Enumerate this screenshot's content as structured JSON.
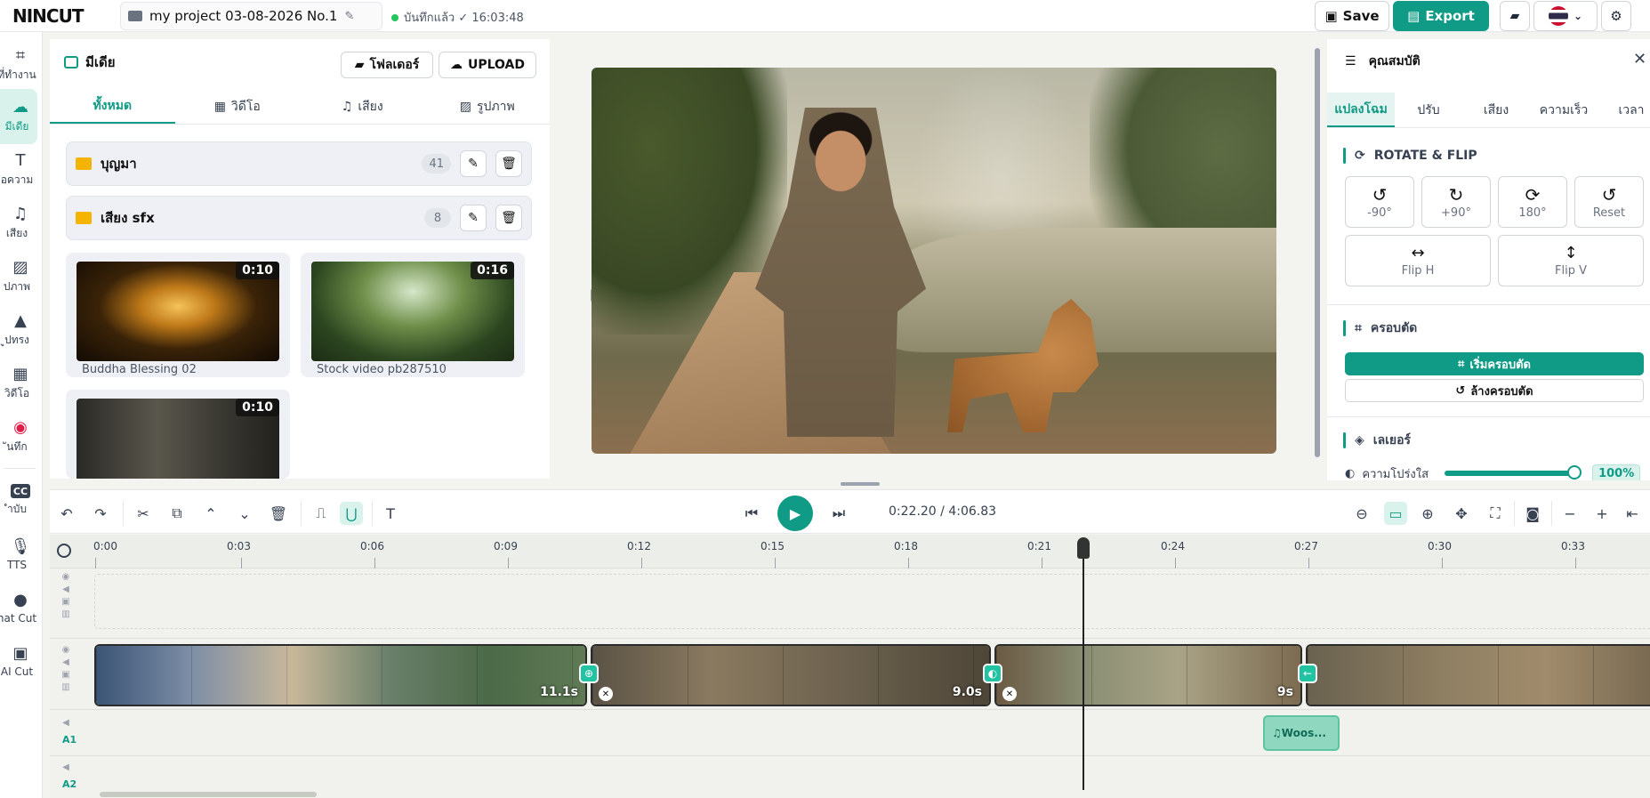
{
  "header": {
    "logo": "NINCUT",
    "project_name": "my project 03-08-2026 No.1",
    "saved_status": "บันทึกแล้ว ✓ 16:03:48",
    "save_label": "Save",
    "export_label": "Export"
  },
  "sidebar": {
    "items": [
      {
        "label": "ที่ทำงาน"
      },
      {
        "label": "มีเดีย"
      },
      {
        "label": "อความ"
      },
      {
        "label": "เสียง"
      },
      {
        "label": "ปภาพ"
      },
      {
        "label": "ูปทรง"
      },
      {
        "label": "วิดีโอ"
      },
      {
        "label": "ันทึก"
      },
      {
        "label": "ำบับ"
      },
      {
        "label": "TTS"
      },
      {
        "label": "hat Cut"
      },
      {
        "label": "AI Cut"
      }
    ]
  },
  "media": {
    "title": "มีเดีย",
    "folder_button": "โฟลเดอร์",
    "upload_button": "UPLOAD",
    "tabs": [
      "ทั้งหมด",
      "วิดีโอ",
      "เสียง",
      "รูปภาพ"
    ],
    "folders": [
      {
        "name": "บุญมา",
        "count": "41"
      },
      {
        "name": "เสียง sfx",
        "count": "8"
      }
    ],
    "cards": [
      {
        "name": "Buddha Blessing 02",
        "duration": "0:10"
      },
      {
        "name": "Stock video pb287510",
        "duration": "0:16"
      },
      {
        "name": "",
        "duration": "0:10"
      }
    ]
  },
  "properties": {
    "title": "คุณสมบัติ",
    "tabs": [
      "แปลงโฉม",
      "ปรับ",
      "เสียง",
      "ความเร็ว",
      "เวลา"
    ],
    "rotate_section": "ROTATE & FLIP",
    "rotate_buttons": [
      "-90°",
      "+90°",
      "180°",
      "Reset"
    ],
    "flip_buttons": [
      "Flip H",
      "Flip V"
    ],
    "crop_section": "ครอบตัด",
    "crop_start": "เริ่มครอบตัด",
    "crop_clear": "ล้างครอบตัด",
    "layer_section": "เลเยอร์",
    "opacity_label": "ความโปร่งใส",
    "opacity_value": "100%"
  },
  "timeline": {
    "timecode": "0:22.20 / 4:06.83",
    "ticks": [
      "0:00",
      "0:03",
      "0:06",
      "0:09",
      "0:12",
      "0:15",
      "0:18",
      "0:21",
      "0:24",
      "0:27",
      "0:30",
      "0:33"
    ],
    "clips": [
      {
        "length": "11.1s"
      },
      {
        "length": "9.0s"
      },
      {
        "length": "9s"
      },
      {
        "length": ""
      }
    ],
    "audio_clip": "Woos...",
    "track_a1": "A1",
    "track_a2": "A2"
  }
}
